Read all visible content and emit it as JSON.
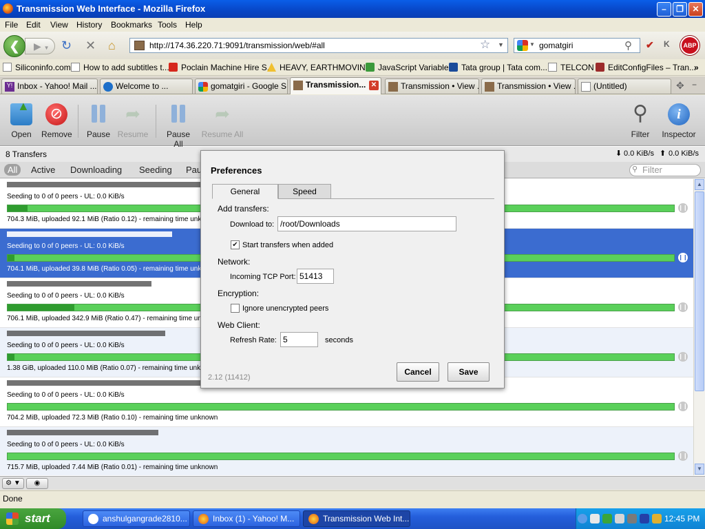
{
  "window": {
    "title": "Transmission Web Interface - Mozilla Firefox"
  },
  "menu": [
    "File",
    "Edit",
    "View",
    "History",
    "Bookmarks",
    "Tools",
    "Help"
  ],
  "nav": {
    "url": "http://174.36.220.71:9091/transmission/web/#all",
    "search_value": "gomatgiri"
  },
  "bookmarks": [
    "Siliconinfo.com",
    "How to add subtitles t...",
    "Poclain Machine Hire S...",
    "HEAVY, EARTHMOVIN...",
    "JavaScript Variables",
    "Tata group | Tata com...",
    "TELCON",
    "EditConfigFiles – Tran..."
  ],
  "tabs": [
    {
      "label": "Inbox - Yahoo! Mail ..."
    },
    {
      "label": "Welcome to ..."
    },
    {
      "label": "gomatgiri - Google S..."
    },
    {
      "label": "Transmission..."
    },
    {
      "label": "Transmission • View ..."
    },
    {
      "label": "Transmission • View ..."
    },
    {
      "label": "(Untitled)"
    }
  ],
  "toolbar": {
    "open": "Open",
    "remove": "Remove",
    "pause": "Pause",
    "resume": "Resume",
    "pause_all": "Pause All",
    "resume_all": "Resume All",
    "filter": "Filter",
    "inspector": "Inspector"
  },
  "status": {
    "transfers": "8 Transfers",
    "down_speed": "0.0 KiB/s",
    "up_speed": "0.0 KiB/s"
  },
  "filters": [
    "All",
    "Active",
    "Downloading",
    "Seeding",
    "Pau"
  ],
  "filter_placeholder": "Filter",
  "torrents": [
    {
      "peers": "Seeding to 0 of 0 peers - UL: 0.0 KiB/s",
      "info": "704.3 MiB, uploaded 92.1 MiB (Ratio 0.12) - remaining time unknown",
      "progress": 0.03,
      "selected": false
    },
    {
      "peers": "Seeding to 0 of 0 peers - UL: 0.0 KiB/s",
      "info": "704.1 MiB, uploaded 39.8 MiB (Ratio 0.05) - remaining time unknown",
      "progress": 0.01,
      "selected": true
    },
    {
      "peers": "Seeding to 0 of 0 peers - UL: 0.0 KiB/s",
      "info": "706.1 MiB, uploaded 342.9 MiB (Ratio 0.47) - remaining time unknown",
      "progress": 0.1,
      "selected": false
    },
    {
      "peers": "Seeding to 0 of 0 peers - UL: 0.0 KiB/s",
      "info": "1.38 GiB, uploaded 110.0 MiB (Ratio 0.07) - remaining time unknown",
      "progress": 0.01,
      "selected": false
    },
    {
      "peers": "Seeding to 0 of 0 peers - UL: 0.0 KiB/s",
      "info": "704.2 MiB, uploaded 72.3 MiB (Ratio 0.10) - remaining time unknown",
      "progress": 0.0,
      "selected": false
    },
    {
      "peers": "Seeding to 0 of 0 peers - UL: 0.0 KiB/s",
      "info": "715.7 MiB, uploaded 7.44 MiB (Ratio 0.01) - remaining time unknown",
      "progress": 0.0,
      "selected": false
    }
  ],
  "prefs": {
    "title": "Preferences",
    "tab_general": "General",
    "tab_speed": "Speed",
    "add_transfers": "Add transfers:",
    "download_to_label": "Download to:",
    "download_to": "/root/Downloads",
    "start_when_added": "Start transfers when added",
    "start_when_added_checked": "✔",
    "network": "Network:",
    "tcp_port_label": "Incoming TCP Port:",
    "tcp_port": "51413",
    "encryption": "Encryption:",
    "ignore_unencrypted": "Ignore unencrypted peers",
    "web_client": "Web Client:",
    "refresh_label": "Refresh Rate:",
    "refresh_rate": "5",
    "seconds": "seconds",
    "cancel": "Cancel",
    "save": "Save",
    "version": "2.12 (11412)"
  },
  "statusbar": "Done",
  "taskbar": {
    "start": "start",
    "tasks": [
      "anshulgangrade2810...",
      "Inbox (1) - Yahoo! M...",
      "Transmission Web Int..."
    ],
    "clock": "12:45 PM"
  }
}
